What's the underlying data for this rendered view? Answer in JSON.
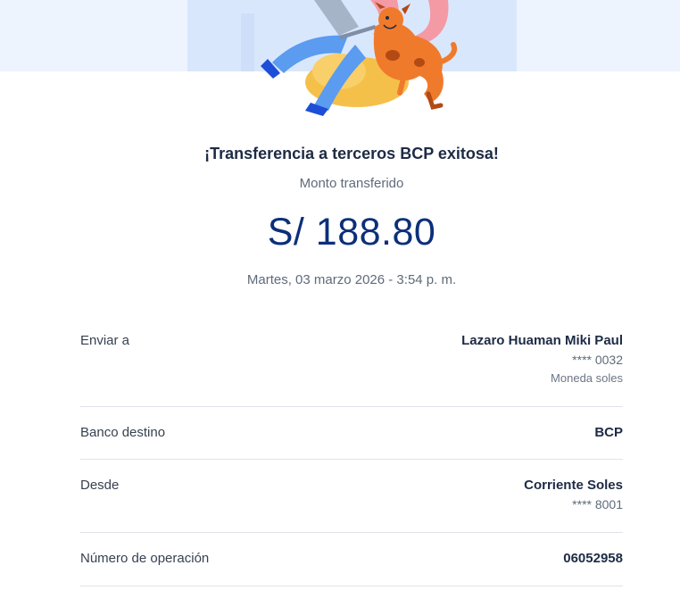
{
  "receipt": {
    "title": "¡Transferencia a terceros BCP exitosa!",
    "amount_label": "Monto transferido",
    "amount": "S/ 188.80",
    "datetime": "Martes, 03 marzo 2026 - 3:54 p. m."
  },
  "details": {
    "send_to": {
      "label": "Enviar a",
      "name": "Lazaro Huaman Miki Paul",
      "account": "**** 0032",
      "currency": "Moneda soles"
    },
    "bank": {
      "label": "Banco destino",
      "value": "BCP"
    },
    "from": {
      "label": "Desde",
      "account_type": "Corriente Soles",
      "account": "**** 8001"
    },
    "operation": {
      "label": "Número de operación",
      "value": "06052958"
    }
  },
  "colors": {
    "hero_bg": "#eef4fe",
    "accent_blue": "#0c2f7a",
    "dog_orange": "#f07a2b",
    "jeans_blue": "#5b9bf0"
  }
}
